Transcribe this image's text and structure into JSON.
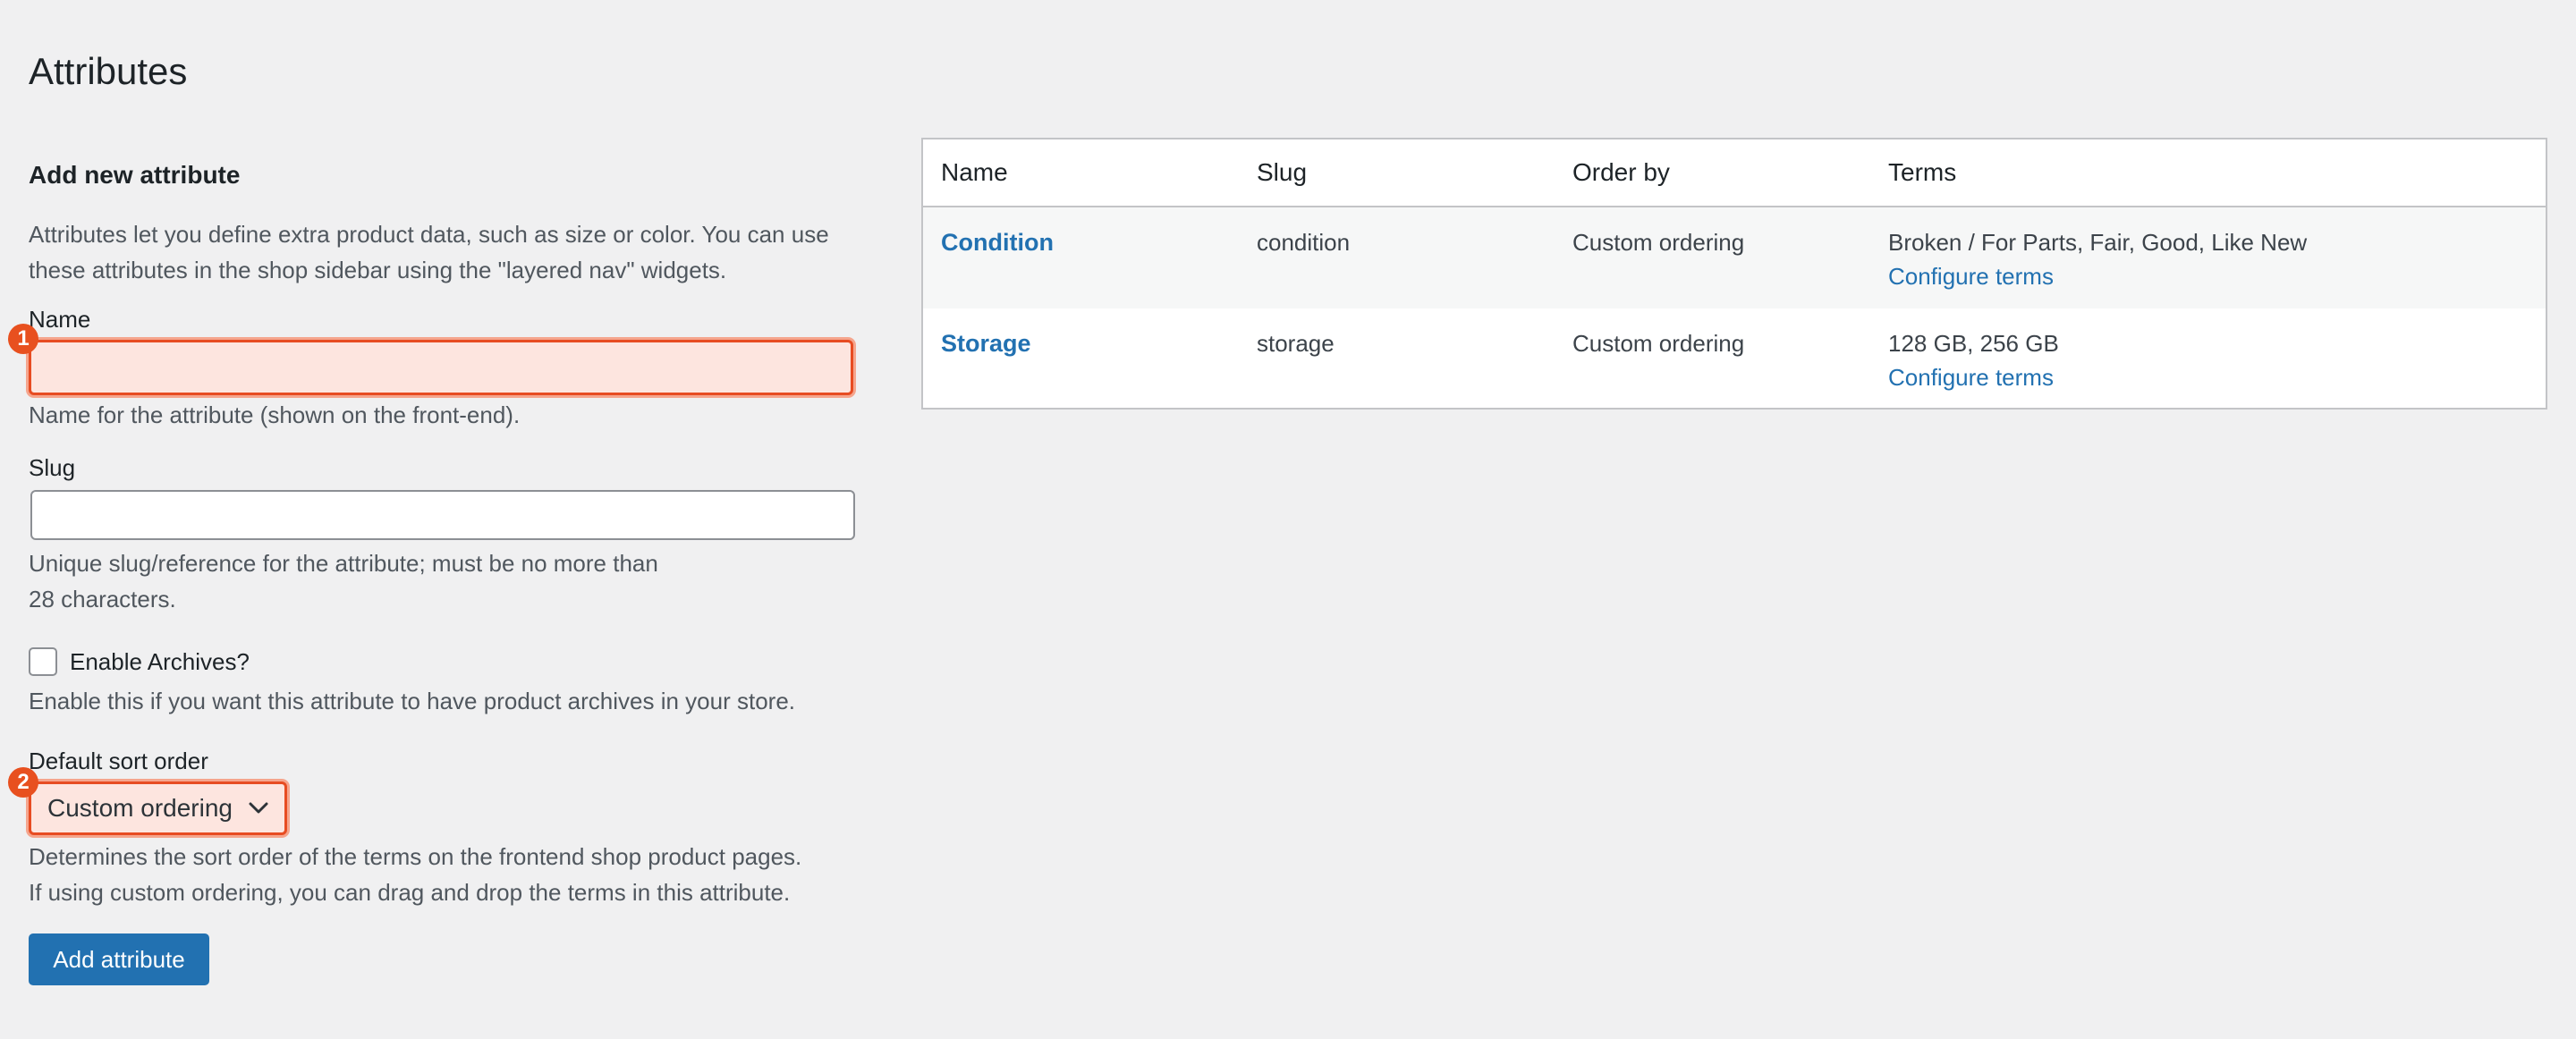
{
  "page": {
    "title": "Attributes"
  },
  "form": {
    "section_title": "Add new attribute",
    "intro": "Attributes let you define extra product data, such as size or color. You can use these attributes in the shop sidebar using the \"layered nav\" widgets.",
    "name": {
      "label": "Name",
      "value": "",
      "help": "Name for the attribute (shown on the front-end).",
      "badge": "1"
    },
    "slug": {
      "label": "Slug",
      "value": "",
      "help_line1": "Unique slug/reference for the attribute; must be no more than",
      "help_line2": "28 characters."
    },
    "archives": {
      "label": "Enable Archives?",
      "checked": false,
      "help": "Enable this if you want this attribute to have product archives in your store."
    },
    "sort": {
      "label": "Default sort order",
      "selected": "Custom ordering",
      "badge": "2",
      "help_line1": "Determines the sort order of the terms on the frontend shop product pages.",
      "help_line2": "If using custom ordering, you can drag and drop the terms in this attribute."
    },
    "submit_label": "Add attribute"
  },
  "table": {
    "headers": {
      "name": "Name",
      "slug": "Slug",
      "order_by": "Order by",
      "terms": "Terms"
    },
    "rows": [
      {
        "name": "Condition",
        "slug": "condition",
        "order_by": "Custom ordering",
        "terms": "Broken / For Parts, Fair, Good, Like New",
        "configure": "Configure terms"
      },
      {
        "name": "Storage",
        "slug": "storage",
        "order_by": "Custom ordering",
        "terms": "128 GB, 256 GB",
        "configure": "Configure terms"
      }
    ]
  },
  "colors": {
    "accent": "#2271b1",
    "highlight": "#e74c22",
    "highlight_fill": "#fde5df"
  }
}
